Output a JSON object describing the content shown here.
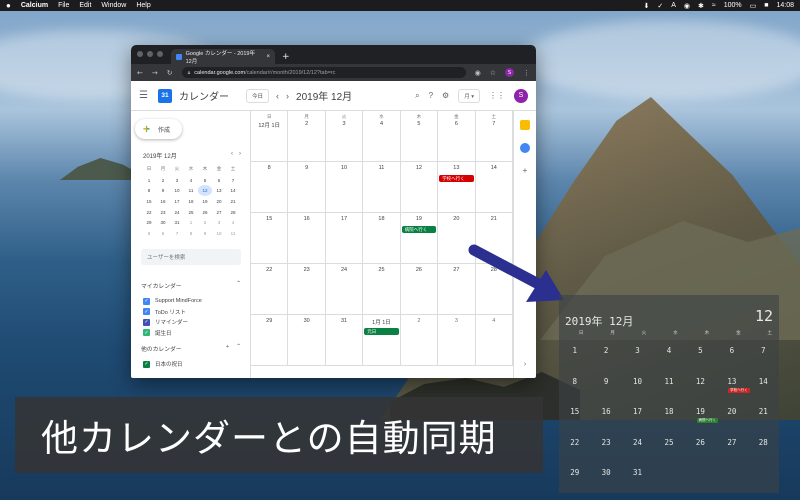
{
  "menubar": {
    "apple": "",
    "items": [
      "Calcium",
      "File",
      "Edit",
      "Window",
      "Help"
    ],
    "status": [
      "⬇",
      "✓",
      "A",
      "◉",
      "wifi",
      "100%",
      "■",
      "S",
      "14:08"
    ]
  },
  "browser": {
    "tab_title": "Google カレンダー - 2019年 12月",
    "url_host": "calendar.google.com",
    "url_path": "/calendar/r/month/2019/12/12?tab=rc",
    "profile_letter": "S"
  },
  "gcal": {
    "app_title": "カレンダー",
    "logo_num": "31",
    "today_btn": "今日",
    "month_title": "2019年 12月",
    "view_label": "月",
    "avatar": "S",
    "create_label": "作成",
    "mini": {
      "title": "2019年 12月",
      "headers": [
        "日",
        "月",
        "火",
        "水",
        "木",
        "金",
        "土"
      ],
      "days": [
        [
          "1",
          "2",
          "3",
          "4",
          "5",
          "6",
          "7"
        ],
        [
          "8",
          "9",
          "10",
          "11",
          "12",
          "13",
          "14"
        ],
        [
          "15",
          "16",
          "17",
          "18",
          "19",
          "20",
          "21"
        ],
        [
          "22",
          "23",
          "24",
          "25",
          "26",
          "27",
          "28"
        ],
        [
          "29",
          "30",
          "31",
          "1",
          "2",
          "3",
          "4"
        ],
        [
          "5",
          "6",
          "7",
          "8",
          "9",
          "10",
          "11"
        ]
      ]
    },
    "search_people": "ユーザーを検索",
    "my_calendars_label": "マイカレンダー",
    "my_calendars": [
      {
        "name": "Support MindForce",
        "color": "#4285f4"
      },
      {
        "name": "ToDo リスト",
        "color": "#4285f4"
      },
      {
        "name": "リマインダー",
        "color": "#3f51b5"
      },
      {
        "name": "誕生日",
        "color": "#33b679"
      }
    ],
    "other_calendars_label": "他のカレンダー",
    "other_calendars": [
      {
        "name": "日本の祝日",
        "color": "#0b8043"
      }
    ],
    "grid": {
      "headers": [
        "日",
        "月",
        "火",
        "水",
        "木",
        "金",
        "土"
      ],
      "rows": [
        [
          "12月 1日",
          "2",
          "3",
          "4",
          "5",
          "6",
          "7"
        ],
        [
          "8",
          "9",
          "10",
          "11",
          "12",
          "13",
          "14"
        ],
        [
          "15",
          "16",
          "17",
          "18",
          "19",
          "20",
          "21"
        ],
        [
          "22",
          "23",
          "24",
          "25",
          "26",
          "27",
          "28"
        ],
        [
          "29",
          "30",
          "31",
          "1月 1日",
          "2",
          "3",
          "4"
        ]
      ],
      "events": {
        "school": "学校へ行く",
        "hospital": "病院へ行く",
        "newyear": "元日"
      },
      "colors": {
        "school": "#d50000",
        "hospital": "#0b8043",
        "newyear": "#0b8043"
      }
    }
  },
  "widget": {
    "title": "2019年  12月",
    "day": "12",
    "headers": [
      "日",
      "月",
      "火",
      "水",
      "木",
      "金",
      "土"
    ],
    "rows": [
      [
        "1",
        "2",
        "3",
        "4",
        "5",
        "6",
        "7"
      ],
      [
        "8",
        "9",
        "10",
        "11",
        "12",
        "13",
        "14"
      ],
      [
        "15",
        "16",
        "17",
        "18",
        "19",
        "20",
        "21"
      ],
      [
        "22",
        "23",
        "24",
        "25",
        "26",
        "27",
        "28"
      ],
      [
        "29",
        "30",
        "31",
        "",
        "",
        "",
        ""
      ]
    ],
    "ev_school": "学校へ行く",
    "ev_hospital": "病院へ行く"
  },
  "caption": "他カレンダーとの自動同期"
}
